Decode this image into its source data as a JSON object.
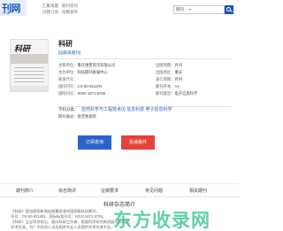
{
  "header": {
    "logo_text": "刊网",
    "logo_sub": "COM",
    "slogan_line1": "汇聚海量 · 期刊资讯",
    "slogan_line2": "创建订阅 · 投稿发布",
    "search_select": "期刊",
    "search_placeholder": ""
  },
  "journal": {
    "cover_title": "科研",
    "title": "科研",
    "badge": "[国家级期刊]",
    "fields": [
      {
        "key": "主管单位：",
        "value": "重庆维普资讯有限公司"
      },
      {
        "key": "主办单位：",
        "value": "科技期刊发展中心"
      },
      {
        "key": "邮发代号：",
        "value": "-"
      },
      {
        "key": "国内刊号：",
        "value": "CN 50-9214/N"
      },
      {
        "key": "国际刊号：",
        "value": "ISSN 1671-5705"
      },
      {
        "key": "出版周期：",
        "value": "月刊"
      },
      {
        "key": "出版地区：",
        "value": "重庆"
      },
      {
        "key": "发行周期：",
        "value": "月刊"
      },
      {
        "key": "期刊开本：",
        "value": "A4"
      },
      {
        "key": "期刊类型：",
        "value": "电子信息科学"
      }
    ],
    "subject_label": "学科分类：",
    "subject_value": "自然科学与工程技术(I) 信息科技 电子信息科学",
    "classification": "期刊收录：维普数据库",
    "subscribe_label": "订阅咨询",
    "submit_label": "投递稿件"
  },
  "tabs": [
    "期刊简介",
    "杂志简评",
    "征稿要求",
    "常见问题",
    "相关期刊"
  ],
  "intro": {
    "heading": "科研杂志简介",
    "lines": [
      "《科研》是由国家新闻出版署批准的国家级科技期刊，",
      "刊号：CN 50-9214/N，国际标准刊号：ISSN 1671-5705，",
      "《科研》立足科技前沿，面向科研工作者，报道科学研究新进展与新成果，",
      "学术交流，为广大科研人员及相关专业人员提供学术交流平台。"
    ],
    "watermark": "东方收录网"
  },
  "colors": {
    "brand": "#1a56b8",
    "link": "#2b5fbf",
    "subscribe": "#2d63c8",
    "submit": "#e5433a",
    "watermark": "#1ebe78"
  }
}
